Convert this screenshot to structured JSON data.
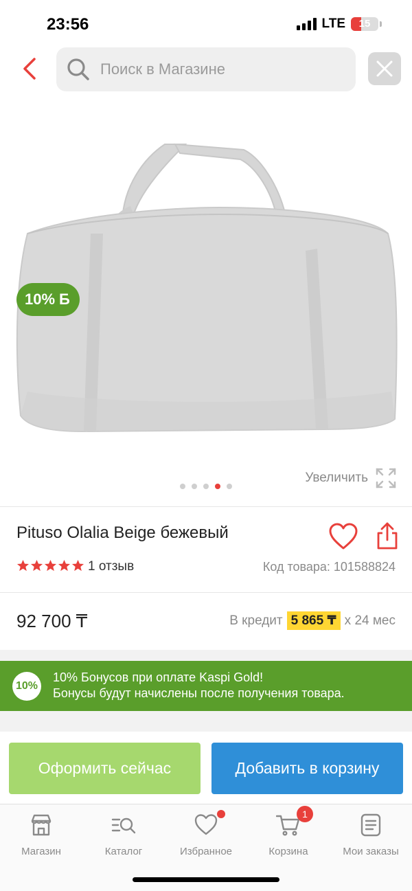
{
  "status_bar": {
    "time": "23:56",
    "network": "LTE",
    "battery": "15"
  },
  "search": {
    "placeholder": "Поиск в Магазине",
    "value": ""
  },
  "gallery": {
    "bonus_badge": {
      "percent": "10%",
      "symbol": "Б"
    },
    "zoom_label": "Увеличить",
    "dots_total": 5,
    "dots_active_index": 3
  },
  "product": {
    "title": "Pituso Olalia Beige бежевый",
    "rating": 5,
    "reviews": "1 отзыв",
    "sku": "Код товара: 101588824",
    "price": "92 700 ₸",
    "credit": {
      "prefix": "В кредит",
      "amount": "5 865 ₸",
      "term": "х 24 мес"
    }
  },
  "promo": {
    "badge": "10%",
    "line1": "10% Бонусов при оплате Kaspi Gold!",
    "line2": "Бонусы будут начислены после получения товара."
  },
  "actions": {
    "order_now": "Оформить сейчас",
    "add_to_cart": "Добавить в корзину"
  },
  "nav": {
    "items": [
      {
        "label": "Магазин",
        "icon": "store-icon"
      },
      {
        "label": "Каталог",
        "icon": "catalog-search-icon"
      },
      {
        "label": "Избранное",
        "icon": "heart-icon"
      },
      {
        "label": "Корзина",
        "icon": "cart-icon",
        "badge": "1"
      },
      {
        "label": "Мои заказы",
        "icon": "orders-icon"
      }
    ]
  },
  "colors": {
    "accent_red": "#e8403b",
    "kaspi_green": "#5a9e2b",
    "order_green": "#a6d86e",
    "cart_blue": "#2f8fd8",
    "credit_yellow": "#ffd633"
  }
}
